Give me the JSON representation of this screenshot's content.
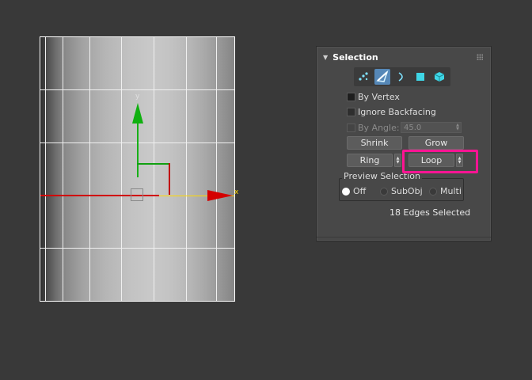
{
  "panel": {
    "title": "Selection",
    "subobject_icons": [
      "vertex-icon",
      "edge-icon",
      "border-icon",
      "polygon-icon",
      "element-icon"
    ],
    "active_subobject": "edge-icon",
    "by_vertex_label": "By Vertex",
    "ignore_backfacing_label": "Ignore Backfacing",
    "by_angle_label": "By Angle:",
    "by_angle_value": "45.0",
    "shrink_label": "Shrink",
    "grow_label": "Grow",
    "ring_label": "Ring",
    "loop_label": "Loop",
    "preview_group_label": "Preview Selection",
    "preview_options": [
      "Off",
      "SubObj",
      "Multi"
    ],
    "preview_selected": "Off",
    "status_text": "18 Edges Selected"
  },
  "gizmo": {
    "y_axis_label": "y",
    "x_axis_label": "x"
  },
  "colors": {
    "highlight": "#ff1493",
    "active_icon": "#5688b8",
    "x_axis": "#d40000",
    "y_axis": "#10b010",
    "selected_edge": "#ffd800"
  }
}
